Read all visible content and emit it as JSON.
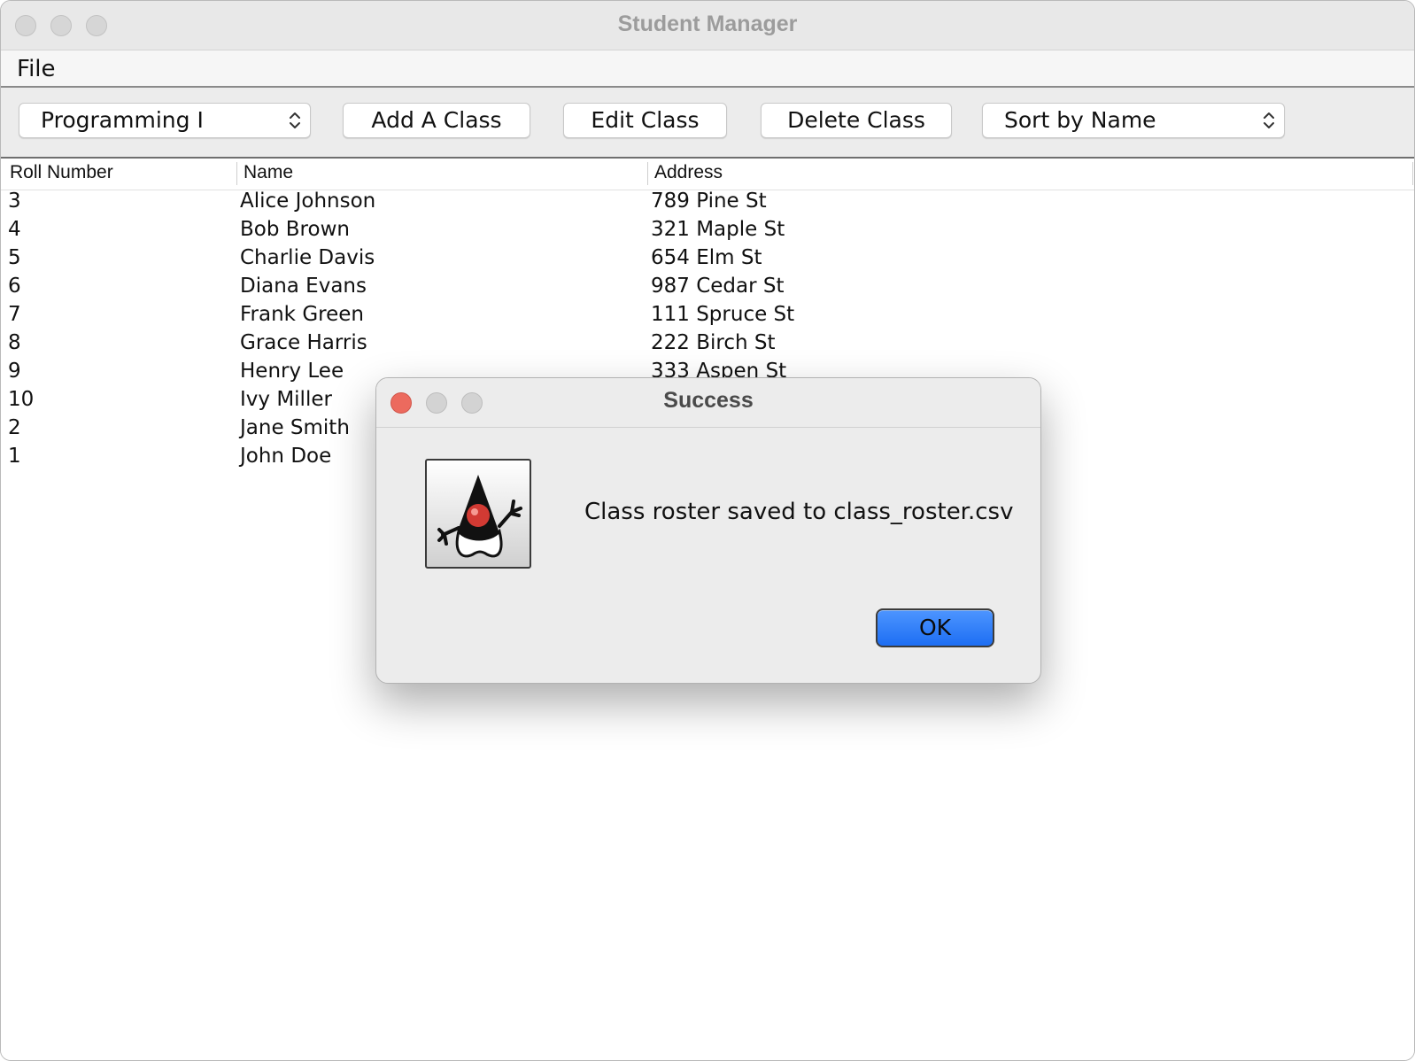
{
  "window": {
    "title": "Student Manager"
  },
  "menu": {
    "file": "File"
  },
  "toolbar": {
    "class_select_value": "Programming I",
    "add_class": "Add A Class",
    "edit_class": "Edit Class",
    "delete_class": "Delete Class",
    "sort_select_value": "Sort by Name"
  },
  "table": {
    "columns": [
      "Roll Number",
      "Name",
      "Address"
    ],
    "rows": [
      {
        "roll": "3",
        "name": "Alice Johnson",
        "address": "789 Pine St"
      },
      {
        "roll": "4",
        "name": "Bob Brown",
        "address": "321 Maple St"
      },
      {
        "roll": "5",
        "name": "Charlie Davis",
        "address": "654 Elm St"
      },
      {
        "roll": "6",
        "name": "Diana Evans",
        "address": "987 Cedar St"
      },
      {
        "roll": "7",
        "name": "Frank Green",
        "address": "111 Spruce St"
      },
      {
        "roll": "8",
        "name": "Grace Harris",
        "address": "222 Birch St"
      },
      {
        "roll": "9",
        "name": "Henry Lee",
        "address": "333 Aspen St"
      },
      {
        "roll": "10",
        "name": "Ivy Miller",
        "address": ""
      },
      {
        "roll": "2",
        "name": "Jane Smith",
        "address": ""
      },
      {
        "roll": "1",
        "name": "John Doe",
        "address": ""
      }
    ]
  },
  "dialog": {
    "title": "Success",
    "icon": "java-duke-icon",
    "message": "Class roster saved to class_roster.csv",
    "ok": "OK"
  },
  "colors": {
    "accent_button": "#1d6ef3",
    "close_button": "#ec6a5e"
  }
}
